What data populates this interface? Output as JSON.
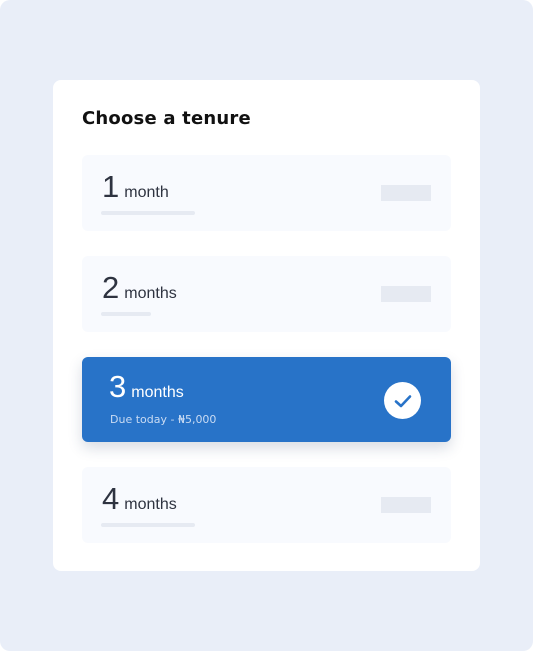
{
  "title": "Choose a tenure",
  "options": [
    {
      "number": "1",
      "unit": "month"
    },
    {
      "number": "2",
      "unit": "months"
    },
    {
      "number": "3",
      "unit": "months",
      "subtitle": "Due today - ₦5,000",
      "selected": true
    },
    {
      "number": "4",
      "unit": "months"
    }
  ],
  "colors": {
    "accent": "#2873C8",
    "background": "#E9EEF8"
  }
}
